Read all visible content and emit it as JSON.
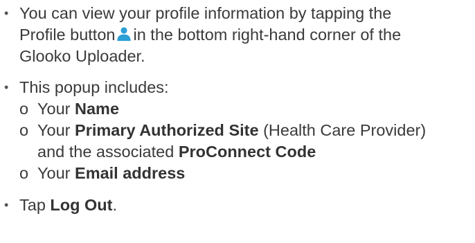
{
  "icons": {
    "bullet": "•",
    "sub_marker": "o",
    "profile": "person-icon",
    "profile_color": "#2b9fd6"
  },
  "item1": {
    "line1": "You can view your profile information by tapping the",
    "line2_before": "Profile button",
    "line2_after": "in the bottom right-hand corner of the",
    "line3": "Glooko Uploader."
  },
  "item2": {
    "intro": "This popup includes:",
    "sub1": {
      "prefix": "Your",
      "bold": "Name"
    },
    "sub2": {
      "prefix": "Your",
      "bold": "Primary Authorized Site",
      "suffix": "(Health Care Provider)",
      "line2_prefix": "and the associated",
      "line2_bold": "ProConnect Code"
    },
    "sub3": {
      "prefix": "Your",
      "bold": "Email address"
    }
  },
  "item3": {
    "prefix": "Tap",
    "bold": "Log Out",
    "suffix": "."
  }
}
